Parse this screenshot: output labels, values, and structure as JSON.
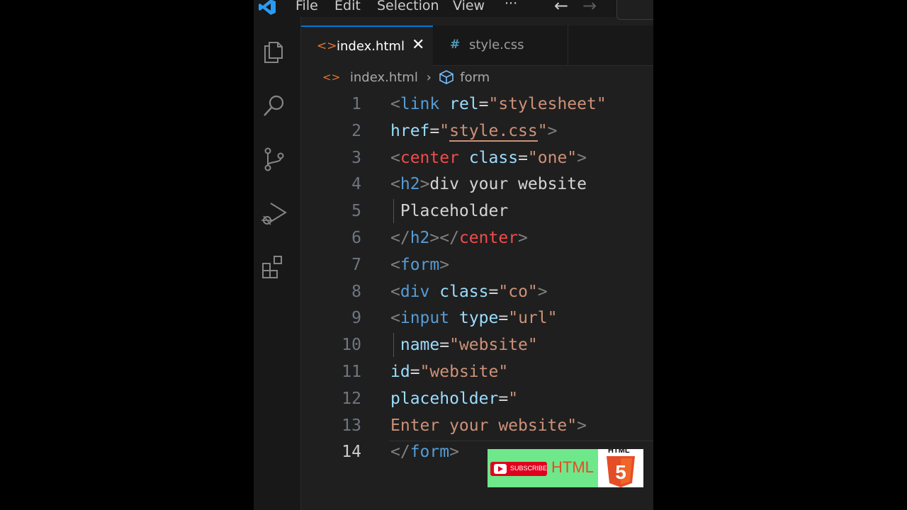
{
  "menu": [
    "File",
    "Edit",
    "Selection",
    "View",
    "···"
  ],
  "nav": {
    "back": "←",
    "forward": "→"
  },
  "activity_icons": [
    "explorer-icon",
    "search-icon",
    "source-control-icon",
    "run-debug-icon",
    "extensions-icon"
  ],
  "tabs": [
    {
      "label": "index.html",
      "icon": "<>",
      "active": true,
      "close": "✕"
    },
    {
      "label": "style.css",
      "icon": "#",
      "active": false
    }
  ],
  "breadcrumb": {
    "file": "index.html",
    "separator": "›",
    "symbol": "form"
  },
  "editor": {
    "current_line": 14,
    "lines": [
      {
        "num": "1",
        "tokens": [
          {
            "t": "<",
            "c": "tg"
          },
          {
            "t": "link",
            "c": "tn"
          },
          {
            "t": " ",
            "c": "pl"
          },
          {
            "t": "rel",
            "c": "at"
          },
          {
            "t": "=",
            "c": "pl"
          },
          {
            "t": "\"stylesheet\"",
            "c": "sv"
          }
        ]
      },
      {
        "num": "2",
        "tokens": [
          {
            "t": "href",
            "c": "at"
          },
          {
            "t": "=",
            "c": "pl"
          },
          {
            "t": "\"",
            "c": "sv"
          },
          {
            "t": "style.css",
            "c": "sv squig"
          },
          {
            "t": "\"",
            "c": "sv"
          },
          {
            "t": ">",
            "c": "tg"
          }
        ]
      },
      {
        "num": "3",
        "tokens": [
          {
            "t": "<",
            "c": "tg"
          },
          {
            "t": "center",
            "c": "tr"
          },
          {
            "t": " ",
            "c": "pl"
          },
          {
            "t": "class",
            "c": "at"
          },
          {
            "t": "=",
            "c": "pl"
          },
          {
            "t": "\"one\"",
            "c": "sv"
          },
          {
            "t": ">",
            "c": "tg"
          }
        ]
      },
      {
        "num": "4",
        "tokens": [
          {
            "t": "<",
            "c": "tg"
          },
          {
            "t": "h2",
            "c": "tn"
          },
          {
            "t": ">",
            "c": "tg"
          },
          {
            "t": "div your website",
            "c": "pl"
          }
        ]
      },
      {
        "num": "5",
        "guide": true,
        "tokens": [
          {
            "t": " Placeholder",
            "c": "pl"
          }
        ]
      },
      {
        "num": "6",
        "tokens": [
          {
            "t": "</",
            "c": "tg"
          },
          {
            "t": "h2",
            "c": "tn"
          },
          {
            "t": "></",
            "c": "tg"
          },
          {
            "t": "center",
            "c": "tr"
          },
          {
            "t": ">",
            "c": "tg"
          }
        ]
      },
      {
        "num": "7",
        "tokens": [
          {
            "t": "<",
            "c": "tg"
          },
          {
            "t": "form",
            "c": "tn"
          },
          {
            "t": ">",
            "c": "tg"
          }
        ]
      },
      {
        "num": "8",
        "tokens": [
          {
            "t": "<",
            "c": "tg"
          },
          {
            "t": "div",
            "c": "tn"
          },
          {
            "t": " ",
            "c": "pl"
          },
          {
            "t": "class",
            "c": "at"
          },
          {
            "t": "=",
            "c": "pl"
          },
          {
            "t": "\"co\"",
            "c": "sv"
          },
          {
            "t": ">",
            "c": "tg"
          }
        ]
      },
      {
        "num": "9",
        "tokens": [
          {
            "t": "<",
            "c": "tg"
          },
          {
            "t": "input",
            "c": "tn"
          },
          {
            "t": " ",
            "c": "pl"
          },
          {
            "t": "type",
            "c": "at"
          },
          {
            "t": "=",
            "c": "pl"
          },
          {
            "t": "\"url\"",
            "c": "sv"
          }
        ]
      },
      {
        "num": "10",
        "guide": true,
        "tokens": [
          {
            "t": " ",
            "c": "pl"
          },
          {
            "t": "name",
            "c": "at"
          },
          {
            "t": "=",
            "c": "pl"
          },
          {
            "t": "\"website\"",
            "c": "sv"
          }
        ]
      },
      {
        "num": "11",
        "tokens": [
          {
            "t": "id",
            "c": "at"
          },
          {
            "t": "=",
            "c": "pl"
          },
          {
            "t": "\"website\"",
            "c": "sv"
          }
        ]
      },
      {
        "num": "12",
        "tokens": [
          {
            "t": "placeholder",
            "c": "at"
          },
          {
            "t": "=",
            "c": "pl"
          },
          {
            "t": "\"",
            "c": "sv"
          }
        ]
      },
      {
        "num": "13",
        "tokens": [
          {
            "t": "Enter your website\"",
            "c": "sv"
          },
          {
            "t": ">",
            "c": "tg"
          }
        ]
      },
      {
        "num": "14",
        "tokens": [
          {
            "t": "</",
            "c": "tg"
          },
          {
            "t": "form",
            "c": "tn"
          },
          {
            "t": ">",
            "c": "tg"
          }
        ]
      }
    ]
  },
  "badge": {
    "subscribe": "SUBSCRIBE",
    "html": "HTML",
    "panel_text": "HTML",
    "html5_digit": "5"
  },
  "colors": {
    "accent": "#0078d4",
    "tag_blue": "#569cd6",
    "attr": "#9cdcfe",
    "string": "#ce9178",
    "tag_red": "#f14c4c",
    "html5_orange": "#e44d26",
    "badge_green": "#6ee88a",
    "youtube_red": "#e1001e"
  }
}
